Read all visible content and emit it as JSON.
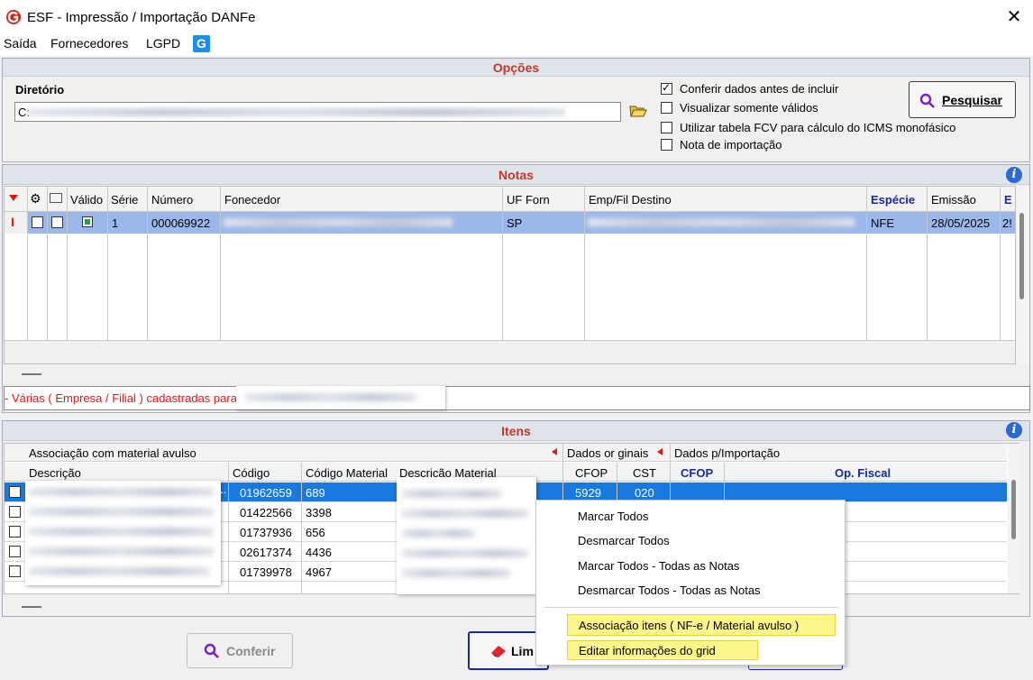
{
  "window": {
    "title": "ESF - Impressão / Importação DANFe",
    "close": "✕"
  },
  "menu": {
    "items": [
      "Saída",
      "Fornecedores",
      "LGPD"
    ],
    "logo": "G"
  },
  "options": {
    "header": "Opções",
    "dir_label": "Diretório",
    "dir_value": "C:",
    "checks": [
      {
        "label": "Conferir dados antes de incluir",
        "checked": true
      },
      {
        "label": "Visualizar somente válidos",
        "checked": false
      },
      {
        "label": "Utilizar tabela FCV para cálculo do ICMS monofásico",
        "checked": false
      },
      {
        "label": "Nota de importação",
        "checked": false
      }
    ],
    "search_btn": "Pesquisar"
  },
  "notes": {
    "header": "Notas",
    "columns": [
      "Válido",
      "Série",
      "Número",
      "Fonecedor",
      "UF Forn",
      "Emp/Fil Destino",
      "Espécie",
      "Emissão",
      "E"
    ],
    "row": {
      "serie": "1",
      "numero": "000069922",
      "uf": "SP",
      "especie": "NFE",
      "emissao": "28/05/2025",
      "extra": "2!"
    },
    "status_text": "- Várias ( Empresa / Filial ) cadastradas para"
  },
  "items": {
    "header": "Itens",
    "group_assoc": "Associação com material avulso",
    "group_dados": "Dados or ginais",
    "group_import": "Dados p/Importação",
    "columns": [
      "Descrição",
      "Código",
      "Código Material",
      "Descrição Material",
      "CFOP",
      "CST",
      "CFOP",
      "Op. Fiscal"
    ],
    "rows": [
      {
        "codigo": "01962659",
        "cod_mat": "689",
        "cfop": "5929",
        "cst": "020"
      },
      {
        "codigo": "01422566",
        "cod_mat": "3398",
        "cfop": "",
        "cst": ""
      },
      {
        "codigo": "01737936",
        "cod_mat": "656",
        "cfop": "",
        "cst": ""
      },
      {
        "codigo": "02617374",
        "cod_mat": "4436",
        "cfop": "",
        "cst": ""
      },
      {
        "codigo": "01739978",
        "cod_mat": "4967",
        "cfop": "",
        "cst": ""
      }
    ]
  },
  "context_menu": {
    "items": [
      "Marcar Todos",
      "Desmarcar Todos",
      "Marcar Todos - Todas as Notas",
      "Desmarcar Todos - Todas as Notas"
    ],
    "highlighted": [
      "Associação itens ( NF-e / Material avulso )",
      "Editar informações do grid"
    ]
  },
  "bottom": {
    "conferir": "Conferir",
    "limpar": "Lim"
  },
  "colors": {
    "header_red": "#c0392b",
    "selection_blue": "#1879e0",
    "highlight_yellow": "#fdf68a"
  }
}
